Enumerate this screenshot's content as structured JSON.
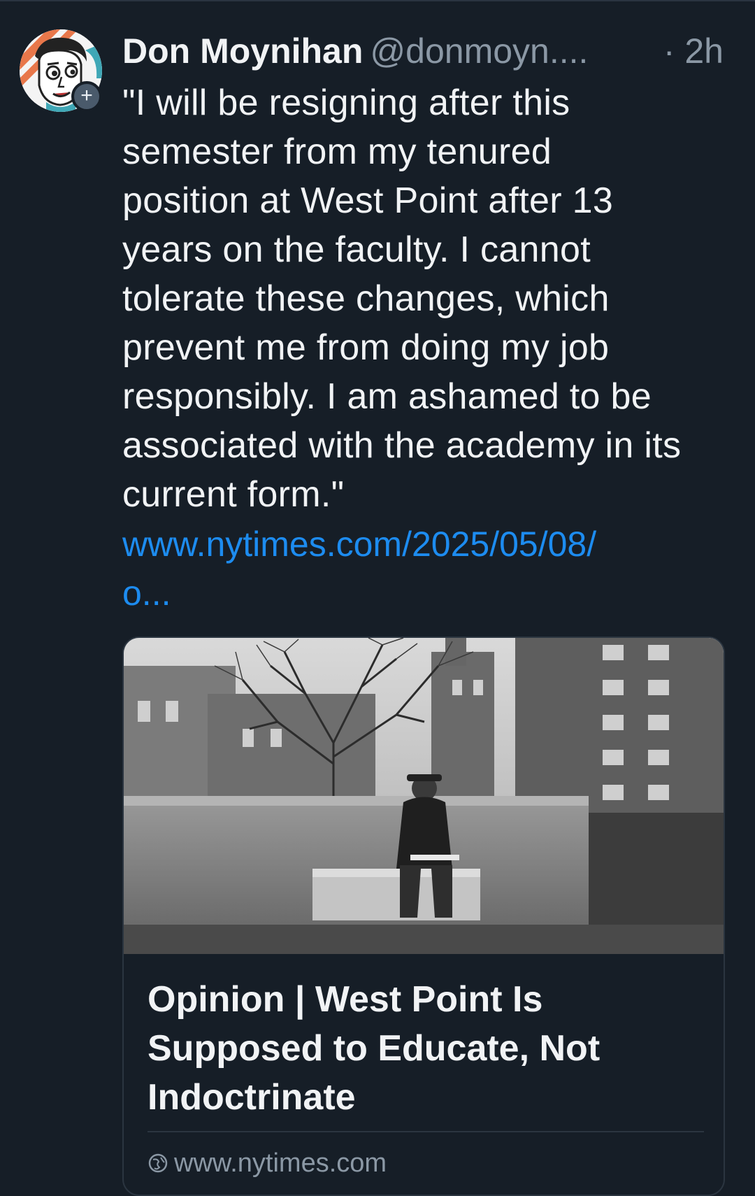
{
  "post": {
    "author_name": "Don Moynihan",
    "author_handle": "@donmoyn....",
    "time": "· 2h",
    "follow_badge": "+",
    "text_lines": [
      "\"I will be resigning after this",
      "semester from my tenured",
      "position at West Point after 13",
      "years on the faculty. I cannot",
      "tolerate these changes, which",
      "prevent me from doing my job",
      "responsibly. I am ashamed to be",
      "associated with the academy in its",
      "current form.\""
    ],
    "link_lines": [
      "www.nytimes.com/2025/05/08/",
      "o..."
    ]
  },
  "card": {
    "title_lines": [
      "Opinion | West Point Is",
      "Supposed to Educate, Not",
      "Indoctrinate"
    ],
    "domain": "www.nytimes.com"
  },
  "icons": {
    "avatar": "cartoon-face-avatar",
    "follow": "plus-icon",
    "domain": "globe-icon"
  },
  "colors": {
    "background": "#161e27",
    "text": "#f1f3f5",
    "muted": "#8b98a5",
    "link": "#1d8cf0",
    "border": "#2b3540"
  }
}
